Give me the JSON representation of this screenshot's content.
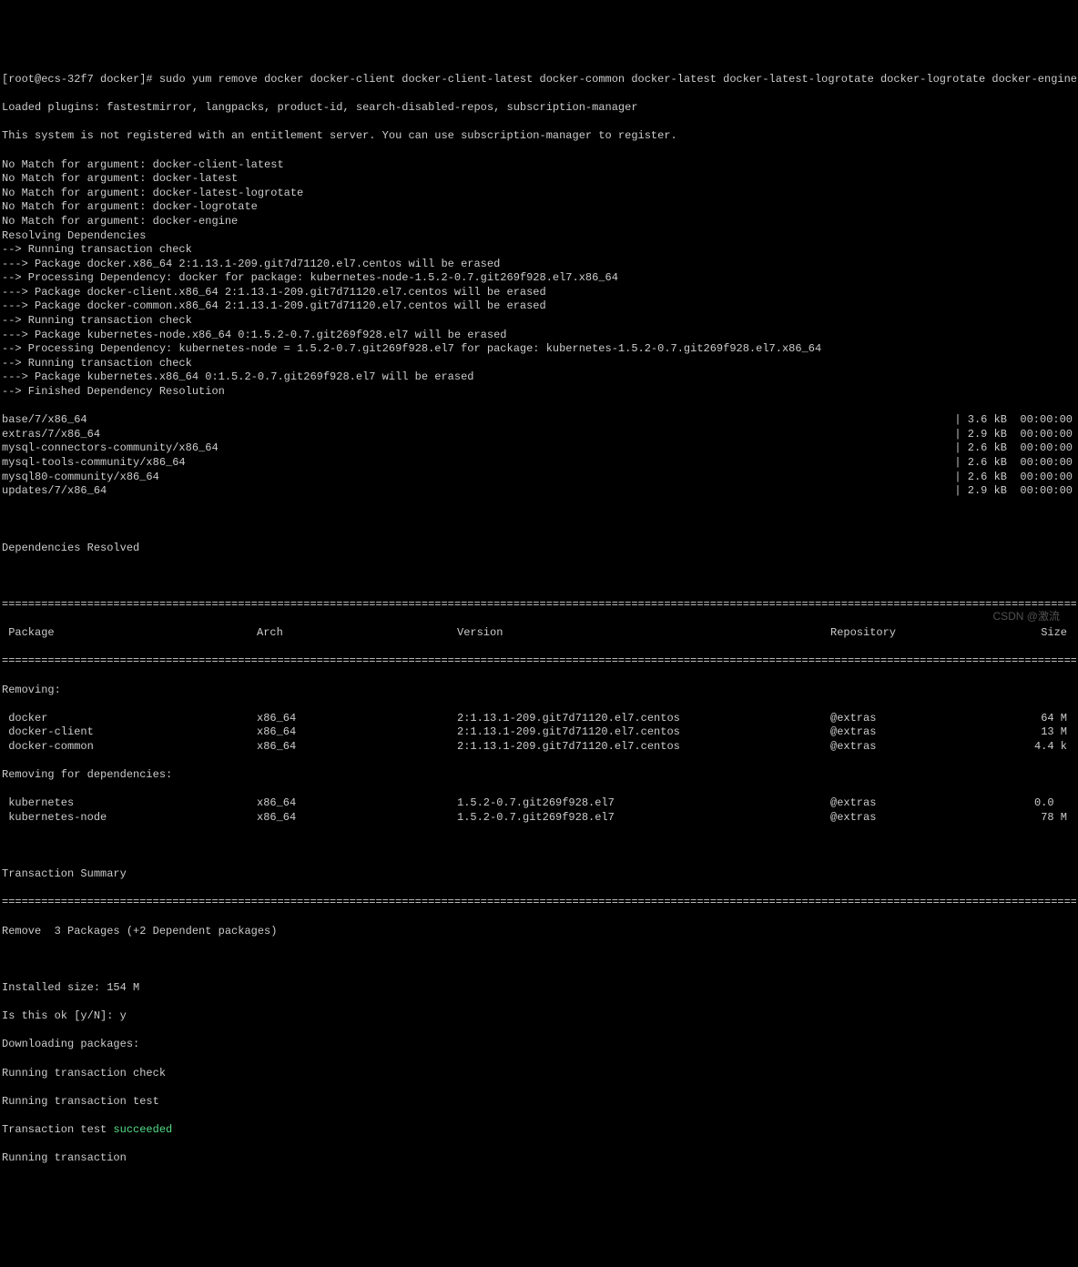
{
  "prompt": {
    "user_host": "[root@ecs-32f7 docker]#",
    "command": "sudo yum remove docker docker-client docker-client-latest docker-common docker-latest docker-latest-logrotate docker-logrotate docker-engine"
  },
  "pre_output": [
    "Loaded plugins: fastestmirror, langpacks, product-id, search-disabled-repos, subscription-manager",
    "",
    "This system is not registered with an entitlement server. You can use subscription-manager to register.",
    "",
    "No Match for argument: docker-client-latest",
    "No Match for argument: docker-latest",
    "No Match for argument: docker-latest-logrotate",
    "No Match for argument: docker-logrotate",
    "No Match for argument: docker-engine",
    "Resolving Dependencies",
    "--> Running transaction check",
    "---> Package docker.x86_64 2:1.13.1-209.git7d71120.el7.centos will be erased",
    "--> Processing Dependency: docker for package: kubernetes-node-1.5.2-0.7.git269f928.el7.x86_64",
    "---> Package docker-client.x86_64 2:1.13.1-209.git7d71120.el7.centos will be erased",
    "---> Package docker-common.x86_64 2:1.13.1-209.git7d71120.el7.centos will be erased",
    "--> Running transaction check",
    "---> Package kubernetes-node.x86_64 0:1.5.2-0.7.git269f928.el7 will be erased",
    "--> Processing Dependency: kubernetes-node = 1.5.2-0.7.git269f928.el7 for package: kubernetes-1.5.2-0.7.git269f928.el7.x86_64",
    "--> Running transaction check",
    "---> Package kubernetes.x86_64 0:1.5.2-0.7.git269f928.el7 will be erased",
    "--> Finished Dependency Resolution"
  ],
  "repos": [
    {
      "name": "base/7/x86_64",
      "size": "3.6 kB",
      "time": "00:00:00"
    },
    {
      "name": "extras/7/x86_64",
      "size": "2.9 kB",
      "time": "00:00:00"
    },
    {
      "name": "mysql-connectors-community/x86_64",
      "size": "2.6 kB",
      "time": "00:00:00"
    },
    {
      "name": "mysql-tools-community/x86_64",
      "size": "2.6 kB",
      "time": "00:00:00"
    },
    {
      "name": "mysql80-community/x86_64",
      "size": "2.6 kB",
      "time": "00:00:00"
    },
    {
      "name": "updates/7/x86_64",
      "size": "2.9 kB",
      "time": "00:00:00"
    }
  ],
  "deps_resolved": "Dependencies Resolved",
  "table": {
    "headers": {
      "package": " Package",
      "arch": "Arch",
      "version": "Version",
      "repo": "Repository",
      "size": "Size"
    },
    "section_removing": "Removing:",
    "section_removing_deps": "Removing for dependencies:",
    "removing": [
      {
        "package": " docker",
        "arch": "x86_64",
        "version": "2:1.13.1-209.git7d71120.el7.centos",
        "repo": "@extras",
        "size": "64 M"
      },
      {
        "package": " docker-client",
        "arch": "x86_64",
        "version": "2:1.13.1-209.git7d71120.el7.centos",
        "repo": "@extras",
        "size": "13 M"
      },
      {
        "package": " docker-common",
        "arch": "x86_64",
        "version": "2:1.13.1-209.git7d71120.el7.centos",
        "repo": "@extras",
        "size": "4.4 k"
      }
    ],
    "removing_deps": [
      {
        "package": " kubernetes",
        "arch": "x86_64",
        "version": "1.5.2-0.7.git269f928.el7",
        "repo": "@extras",
        "size": "0.0  "
      },
      {
        "package": " kubernetes-node",
        "arch": "x86_64",
        "version": "1.5.2-0.7.git269f928.el7",
        "repo": "@extras",
        "size": "78 M"
      }
    ]
  },
  "tx_summary_label": "Transaction Summary",
  "tx_summary_line": "Remove  3 Packages (+2 Dependent packages)",
  "post_output": {
    "installed_size": "Installed size: 154 M",
    "confirm": "Is this ok [y/N]: y",
    "downloading": "Downloading packages:",
    "check": "Running transaction check",
    "test": "Running transaction test",
    "succeeded_prefix": "Transaction test ",
    "succeeded_word": "succeeded",
    "running": "Running transaction"
  },
  "watermark": "CSDN @激流"
}
